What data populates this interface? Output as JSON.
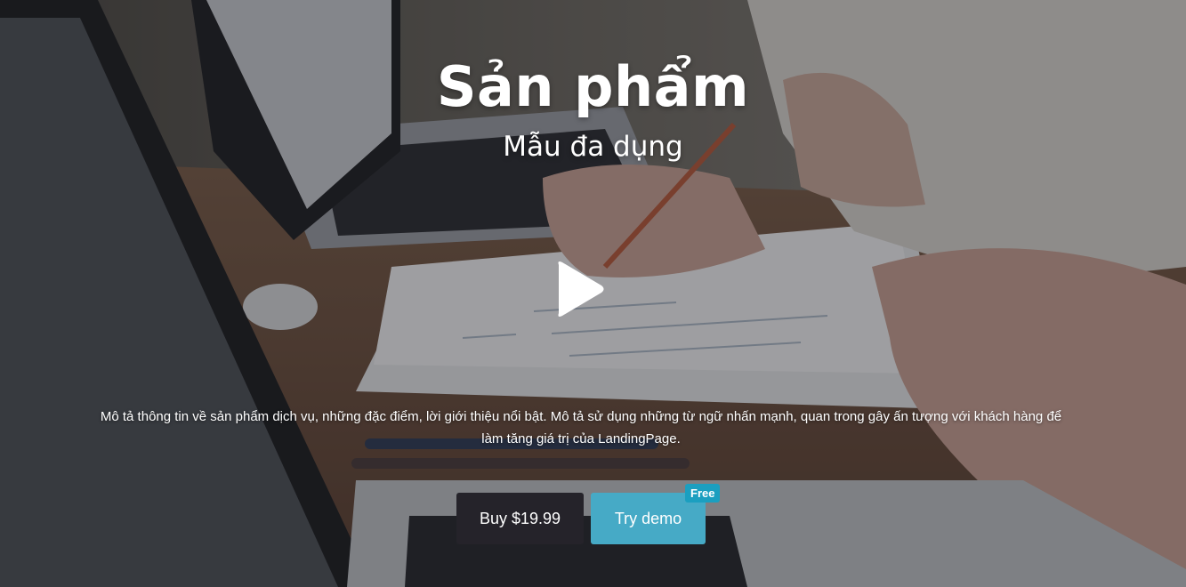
{
  "hero": {
    "title": "Sản phẩm",
    "subtitle": "Mẫu đa dụng",
    "description": "Mô tả thông tin về sản phẩm dịch vụ, những đặc điểm, lời giới thiệu nổi bật. Mô tả sử dụng những từ ngữ nhấn mạnh, quan trong gây ấn tượng với khách hàng để làm tăng giá trị của LandingPage.",
    "play_icon": "play-icon"
  },
  "actions": {
    "buy_label": "Buy $19.99",
    "demo_label": "Try demo",
    "demo_badge": "Free"
  },
  "colors": {
    "buy_button": "#25232a",
    "demo_button": "#46aac6",
    "badge": "#1b9fc0",
    "text": "#ffffff"
  }
}
